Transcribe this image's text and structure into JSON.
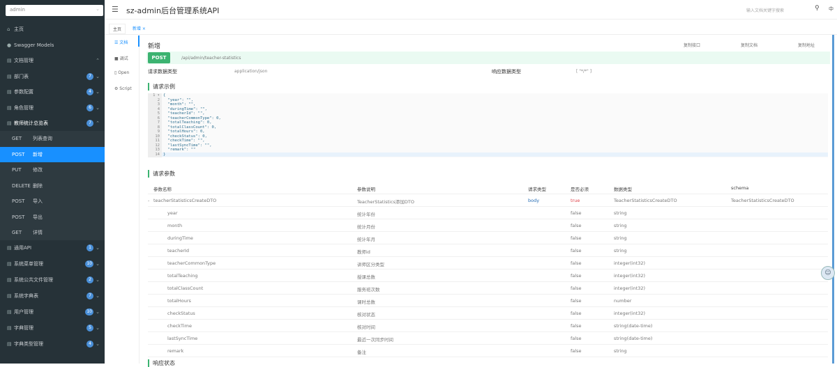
{
  "sidebar": {
    "search_value": "admin",
    "items": [
      {
        "label": "主页",
        "icon": "home-icon"
      },
      {
        "label": "Swagger Models",
        "icon": "model-icon"
      },
      {
        "label": "文档管理",
        "icon": "doc-icon"
      },
      {
        "label": "部门表",
        "badge": "7"
      },
      {
        "label": "参数配置",
        "badge": "4"
      },
      {
        "label": "角色管理",
        "badge": "6"
      },
      {
        "label": "教师统计总览表",
        "badge": "7"
      }
    ],
    "submenu": [
      {
        "method": "GET",
        "label": "列表查询"
      },
      {
        "method": "POST",
        "label": "新增",
        "active": true
      },
      {
        "method": "PUT",
        "label": "修改"
      },
      {
        "method": "DELETE",
        "label": "删除"
      },
      {
        "method": "POST",
        "label": "导入"
      },
      {
        "method": "POST",
        "label": "导出"
      },
      {
        "method": "GET",
        "label": "详情"
      }
    ],
    "groups": [
      {
        "label": "通用API",
        "badge": "1"
      },
      {
        "label": "系统菜单管理",
        "badge": "10"
      },
      {
        "label": "系统公共文件管理",
        "badge": "2"
      },
      {
        "label": "系统字典表",
        "badge": "7"
      },
      {
        "label": "用户管理",
        "badge": "10"
      },
      {
        "label": "字典管理",
        "badge": "5"
      },
      {
        "label": "字典类型管理",
        "badge": "4"
      }
    ]
  },
  "header": {
    "title": "sz-admin后台管理系统API",
    "search_placeholder": "输入文档关键字搜索",
    "lang": "中"
  },
  "tabs": {
    "home": "主页",
    "current": "新增 ×"
  },
  "doc_tabs": [
    "文档",
    "调试",
    "Open",
    "Script"
  ],
  "operation": {
    "title": "新增",
    "copy_api": "复制接口",
    "copy_doc": "复制文档",
    "copy_url": "复制地址",
    "method": "POST",
    "path": "/api/admin/teacher-statistics",
    "req_type_label": "请求数据类型",
    "req_type": "application/json",
    "resp_type_label": "响应数据类型",
    "resp_type": "[ \"*/*\" ]"
  },
  "request_example": {
    "title": "请求示例",
    "lines": [
      "{",
      "  \"year\": \"\",",
      "  \"month\": \"\",",
      "  \"duringTime\": \"\",",
      "  \"teacherId\": \"\",",
      "  \"teacherCommonType\": 0,",
      "  \"totalTeaching\": 0,",
      "  \"totalClassCount\": 0,",
      "  \"totalHours\": 0,",
      "  \"checkStatus\": 0,",
      "  \"checkTime\": \"\",",
      "  \"lastSyncTime\": \"\",",
      "  \"remark\": \"\"",
      "}"
    ]
  },
  "request_params": {
    "title": "请求参数",
    "headers": [
      "参数名称",
      "参数说明",
      "请求类型",
      "是否必须",
      "数据类型",
      "schema"
    ],
    "rows": [
      [
        "teacherStatisticsCreateDTO",
        "TeacherStatistics添加DTO",
        "body",
        "true",
        "TeacherStatisticsCreateDTO",
        "TeacherStatisticsCreateDTO"
      ],
      [
        "year",
        "统计年份",
        "",
        "false",
        "string",
        ""
      ],
      [
        "month",
        "统计月份",
        "",
        "false",
        "string",
        ""
      ],
      [
        "duringTime",
        "统计年月",
        "",
        "false",
        "string",
        ""
      ],
      [
        "teacherId",
        "教师id",
        "",
        "false",
        "string",
        ""
      ],
      [
        "teacherCommonType",
        "讲师区分类型",
        "",
        "false",
        "integer(int32)",
        ""
      ],
      [
        "totalTeaching",
        "授课总数",
        "",
        "false",
        "integer(int32)",
        ""
      ],
      [
        "totalClassCount",
        "服务班次数",
        "",
        "false",
        "integer(int32)",
        ""
      ],
      [
        "totalHours",
        "课时总数",
        "",
        "false",
        "number",
        ""
      ],
      [
        "checkStatus",
        "核对状态",
        "",
        "false",
        "integer(int32)",
        ""
      ],
      [
        "checkTime",
        "核对时间",
        "",
        "false",
        "string(date-time)",
        ""
      ],
      [
        "lastSyncTime",
        "最近一次同步时间",
        "",
        "false",
        "string(date-time)",
        ""
      ],
      [
        "remark",
        "备注",
        "",
        "false",
        "string",
        ""
      ]
    ]
  },
  "response_status": {
    "title": "响应状态"
  },
  "colors": {
    "sidebar": "#263238",
    "active": "#1890ff",
    "post": "#3cb371",
    "required": "#e0434b",
    "body": "#2a6fb5"
  }
}
